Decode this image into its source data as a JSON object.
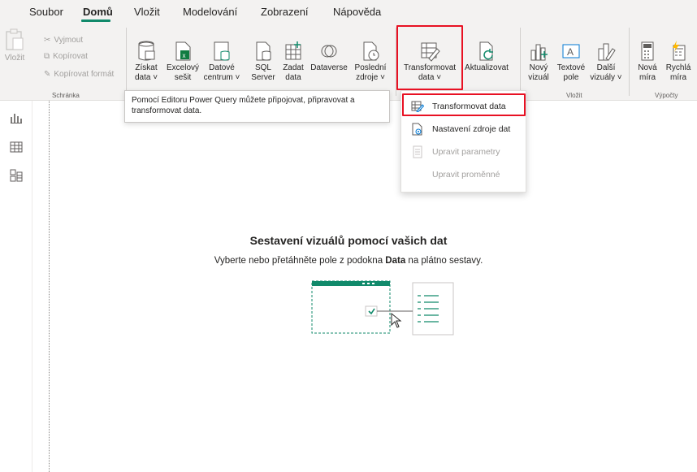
{
  "menu": {
    "items": [
      "Soubor",
      "Domů",
      "Vložit",
      "Modelování",
      "Zobrazení",
      "Nápověda"
    ],
    "active": "Domů"
  },
  "ribbon": {
    "clipboard": {
      "paste": "Vložit",
      "cut": "Vyjmout",
      "copy": "Kopírovat",
      "format_painter": "Kopírovat formát",
      "group_label": "Schránka"
    },
    "data": {
      "get_data": [
        "Získat",
        "data ˅"
      ],
      "excel": [
        "Excelový",
        "sešit"
      ],
      "datacenter": [
        "Datové",
        "centrum ˅"
      ],
      "sql": [
        "SQL",
        "Server"
      ],
      "enter": [
        "Zadat",
        "data"
      ],
      "dataverse": [
        "Dataverse",
        ""
      ],
      "recent": [
        "Poslední",
        "zdroje ˅"
      ]
    },
    "queries": {
      "transform": [
        "Transformovat",
        "data ˅"
      ],
      "refresh": [
        "Aktualizovat",
        ""
      ]
    },
    "insert": {
      "new_visual": [
        "Nový",
        "vizuál"
      ],
      "text_box": [
        "Textové",
        "pole"
      ],
      "more_visuals": [
        "Další",
        "vizuály ˅"
      ],
      "group_label": "Vložit"
    },
    "calc": {
      "new_measure": [
        "Nová",
        "míra"
      ],
      "quick_measure": [
        "Rychlá",
        "míra"
      ],
      "group_label": "Výpočty"
    }
  },
  "tooltip": {
    "text": "Pomocí Editoru Power Query můžete připojovat, připravovat a transformovat data."
  },
  "dropdown": {
    "items": [
      {
        "label": "Transformovat data",
        "enabled": true
      },
      {
        "label": "Nastavení zdroje dat",
        "enabled": true
      },
      {
        "label": "Upravit parametry",
        "enabled": false
      },
      {
        "label": "Upravit proměnné",
        "enabled": false
      }
    ]
  },
  "empty_state": {
    "title": "Sestavení vizuálů pomocí vašich dat",
    "subtitle_before": "Vyberte nebo přetáhněte pole z podokna ",
    "subtitle_bold": "Data",
    "subtitle_after": " na plátno sestavy."
  },
  "colors": {
    "accent": "#118a6b",
    "highlight": "#e81123",
    "ribbon_bg": "#f3f2f1",
    "disabled": "#a19f9d"
  }
}
